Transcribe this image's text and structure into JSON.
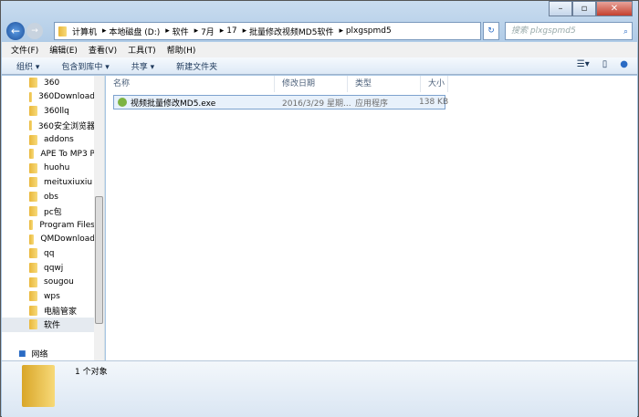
{
  "address": {
    "crumbs": [
      "计算机",
      "本地磁盘 (D:)",
      "软件",
      "7月",
      "17",
      "批量修改视频MD5软件",
      "plxgspmd5"
    ],
    "search_placeholder": "搜索 plxgspmd5"
  },
  "menu": [
    "文件(F)",
    "编辑(E)",
    "查看(V)",
    "工具(T)",
    "帮助(H)"
  ],
  "toolbar": {
    "organize": "组织 ▾",
    "include": "包含到库中 ▾",
    "share": "共享 ▾",
    "new_folder": "新建文件夹"
  },
  "sidebar": {
    "items": [
      "360",
      "360Download",
      "360llq",
      "360安全浏览器",
      "addons",
      "APE To MP3 P",
      "huohu",
      "meituxiuxiu",
      "obs",
      "pc包",
      "Program Files",
      "QMDownload",
      "qq",
      "qqwj",
      "sougou",
      "wps",
      "电脑管家",
      "软件"
    ],
    "network": "网络"
  },
  "columns": [
    "名称",
    "修改日期",
    "类型",
    "大小"
  ],
  "files": [
    {
      "name": "视频批量修改MD5.exe",
      "date": "2016/3/29 星期...",
      "type": "应用程序",
      "size": "138 KB"
    }
  ],
  "status": {
    "count": "1 个对象"
  }
}
